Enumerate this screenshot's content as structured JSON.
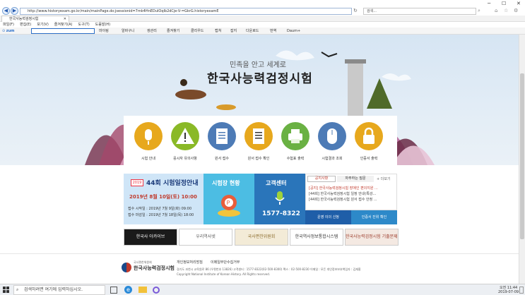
{
  "browser": {
    "url": "http://www.historyexam.go.kr/main/mainPage.do;jsessionid=7mk4HnEDuIOqlb2dCje-V-=GkrG.historyexamE",
    "search_placeholder": "검색...",
    "tab_title": "한국사능력검정시험",
    "menu": [
      "파일(F)",
      "편집(E)",
      "보기(V)",
      "즐겨찾기(A)",
      "도구(T)",
      "도움말(H)"
    ],
    "toolbar": {
      "zum": "zum",
      "items": [
        "마이링",
        "알바구니",
        "쌍관리",
        "즐겨찾기",
        "클리우드",
        "캡쳐",
        "잡지",
        "다운로드",
        "번역",
        "Daum+"
      ]
    }
  },
  "hero": {
    "subtitle": "민족을 안고 세계로",
    "title": "한국사능력검정시험"
  },
  "services": [
    {
      "label": "시험 안내",
      "color": "#e7a81d",
      "icon": "microphone-icon"
    },
    {
      "label": "응시자 유의사항",
      "color": "#8ab927",
      "icon": "warning-icon"
    },
    {
      "label": "원서 접수",
      "color": "#4d7bb6",
      "icon": "document-icon"
    },
    {
      "label": "원서 접수 확인",
      "color": "#e7a81d",
      "icon": "list-check-icon"
    },
    {
      "label": "수험표 출력",
      "color": "#6ab143",
      "icon": "printer-icon"
    },
    {
      "label": "시험결과 조회",
      "color": "#4d7bb6",
      "icon": "mouse-icon"
    },
    {
      "label": "인증서 출력",
      "color": "#e7a81d",
      "icon": "lock-icon"
    }
  ],
  "exam_panel": {
    "badge": "2019",
    "title": "44회 시험일정안내",
    "date": "2019년 8월 10일(토) 10:00",
    "line1": "접수 시작일 : 2019년   7월   9일(화) 09:00",
    "line2": "접수 마감일 : 2019년   7월 18일(목) 18:00"
  },
  "hall_panel": {
    "title": "시험장 현황"
  },
  "center_panel": {
    "title": "고객센터",
    "phone": "1577-8322"
  },
  "notice_panel": {
    "tabs": [
      "공지사항",
      "자주하는 질문"
    ],
    "more": "+ 더보기",
    "items": [
      "[공지] 한국사능력검정시험 장애인 편의지원 ...",
      "[44회] 한국사능력검정시험 일정 안내(특강...",
      "[44회] 한국사능력검정시험 원서 접수 안정 ..."
    ]
  },
  "buttons": {
    "exempt": "운영 이의 신청",
    "identity": "인증서 진위 확인"
  },
  "banners": [
    {
      "label": "한국사 아카이브",
      "bg": "#1a1a1a",
      "fg": "#ffffff"
    },
    {
      "label": "우리역사넷",
      "bg": "#ffffff",
      "fg": "#555555"
    },
    {
      "label": "국사편찬위원회",
      "bg": "#f3ebd7",
      "fg": "#8a6a2a"
    },
    {
      "label": "한국역사정보통합시스템",
      "bg": "#ffffff",
      "fg": "#333333"
    },
    {
      "label": "한국사능력검정시험 기출문제풀기",
      "bg": "#f4e9e2",
      "fg": "#9a3a2a"
    }
  ],
  "footer": {
    "logo_small": "국사편찬위원회",
    "logo": "한국사능력검정시험",
    "links": [
      "개인정보처리방침",
      "이메일무단수집거부"
    ],
    "addr": "경기도 과천시 교육원로 86 (우편번호 13826) 고객센터 : 1577-8322(02-500-8300) 팩스 : 02-500-8230 이메일 : 모든 개인정보보호책임자 : 김재홍",
    "copy": "Copyright National Institute of Korean History. All Rights reserved."
  },
  "taskbar": {
    "search": "검색하려면 여기에 입력하십시오.",
    "time": "오전 11:44",
    "date": "2019-07-09"
  }
}
